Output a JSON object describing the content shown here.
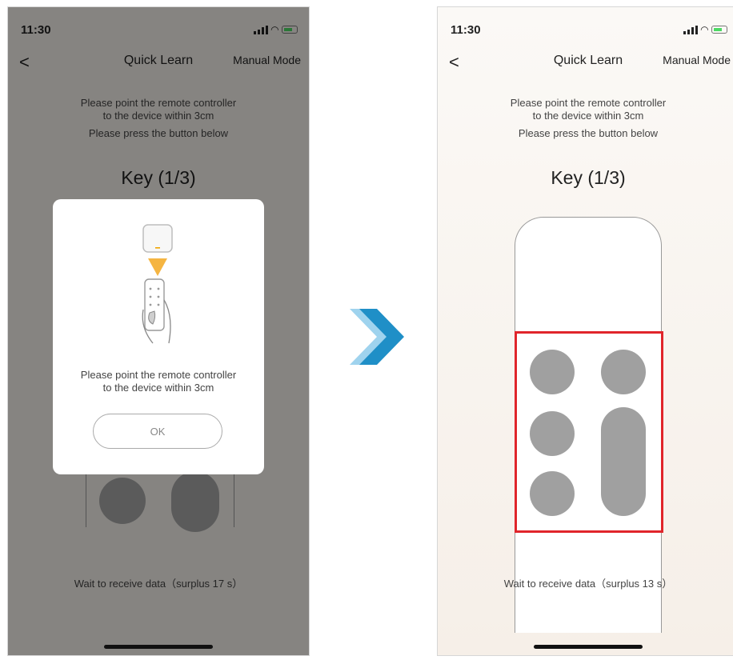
{
  "left_screen": {
    "status_time": "11:30",
    "nav": {
      "back": "<",
      "title": "Quick Learn",
      "manual_mode": "Manual Mode"
    },
    "instruction_line1": "Please point the remote controller",
    "instruction_line2": "to the device within 3cm",
    "instruction_line3": "Please press the button below",
    "key_title": "Key (1/3)",
    "dialog": {
      "text_line1": "Please point the remote controller",
      "text_line2": "to the device within 3cm",
      "ok_label": "OK"
    },
    "wait_text": "Wait to receive data（surplus 17 s）"
  },
  "right_screen": {
    "status_time": "11:30",
    "nav": {
      "back": "<",
      "title": "Quick Learn",
      "manual_mode": "Manual Mode"
    },
    "instruction_line1": "Please point the remote controller",
    "instruction_line2": "to the device within 3cm",
    "instruction_line3": "Please press the button below",
    "key_title": "Key (1/3)",
    "wait_text": "Wait to receive data（surplus 13 s）"
  },
  "colors": {
    "highlight": "#e0252b",
    "arrow": "#1f8fc7",
    "overlay": "rgba(0,0,0,0.45)",
    "button_gray": "#a0a0a0"
  },
  "icons": [
    "chevron-left-icon",
    "signal-icon",
    "wifi-icon",
    "battery-icon",
    "remote-illustration-icon",
    "next-arrow-icon"
  ]
}
